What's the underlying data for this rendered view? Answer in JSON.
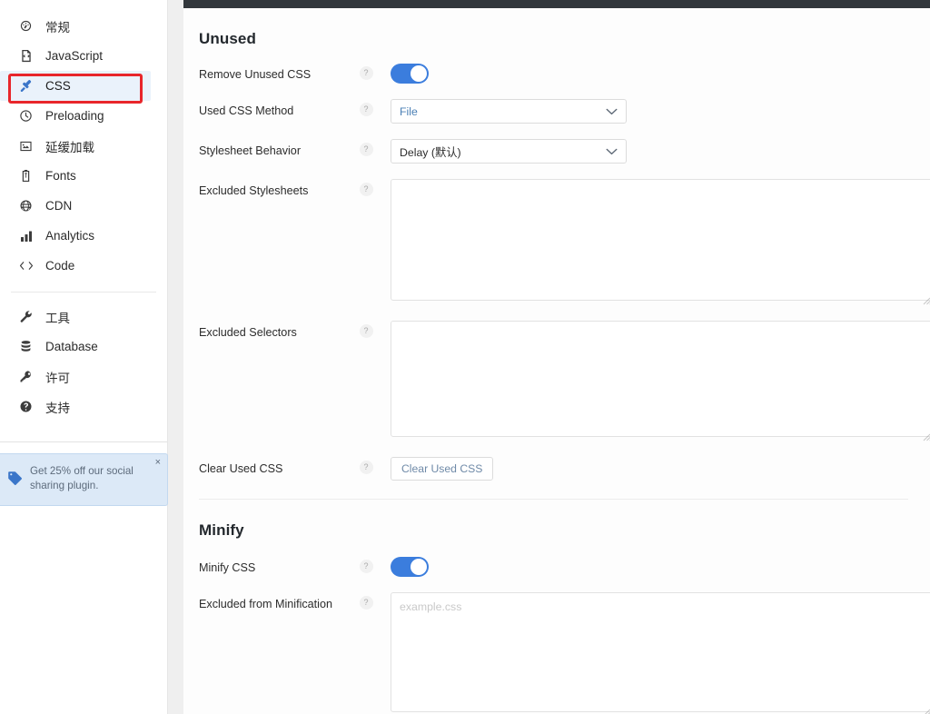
{
  "sidebar": {
    "groups": [
      {
        "items": [
          {
            "label": "常规",
            "icon": "gauge-icon",
            "active": false
          },
          {
            "label": "JavaScript",
            "icon": "code-file-icon",
            "active": false
          },
          {
            "label": "CSS",
            "icon": "paintbrush-icon",
            "active": true
          },
          {
            "label": "Preloading",
            "icon": "clock-icon",
            "active": false
          },
          {
            "label": "延缓加载",
            "icon": "image-icon",
            "active": false
          },
          {
            "label": "Fonts",
            "icon": "font-clipboard-icon",
            "active": false
          },
          {
            "label": "CDN",
            "icon": "globe-icon",
            "active": false
          },
          {
            "label": "Analytics",
            "icon": "bar-chart-icon",
            "active": false
          },
          {
            "label": "Code",
            "icon": "code-brackets-icon",
            "active": false
          }
        ]
      },
      {
        "items": [
          {
            "label": "工具",
            "icon": "wrench-icon",
            "active": false
          },
          {
            "label": "Database",
            "icon": "database-icon",
            "active": false
          },
          {
            "label": "许可",
            "icon": "key-icon",
            "active": false
          },
          {
            "label": "支持",
            "icon": "help-circle-icon",
            "active": false
          }
        ]
      }
    ],
    "promo": {
      "text": "Get 25% off our social sharing plugin.",
      "close_label": "×",
      "icon": "price-tag-icon",
      "bg_color": "#dce9f7",
      "accent_color": "#3b76c9"
    },
    "annotation": {
      "target": "CSS",
      "color": "#e8262b"
    }
  },
  "content": {
    "sections": [
      {
        "title": "Unused",
        "rows": [
          {
            "label": "Remove Unused CSS",
            "help": "?",
            "control": "toggle",
            "toggle_on": true
          },
          {
            "label": "Used CSS Method",
            "help": "?",
            "control": "select",
            "value": "File"
          },
          {
            "label": "Stylesheet Behavior",
            "help": "?",
            "control": "select",
            "value": "Delay (默认)"
          },
          {
            "label": "Excluded Stylesheets",
            "help": "?",
            "control": "textarea",
            "value": "",
            "placeholder": ""
          },
          {
            "label": "Excluded Selectors",
            "help": "?",
            "control": "textarea",
            "value": "",
            "placeholder": ""
          },
          {
            "label": "Clear Used CSS",
            "help": "?",
            "control": "button",
            "button_label": "Clear Used CSS"
          }
        ]
      },
      {
        "title": "Minify",
        "rows": [
          {
            "label": "Minify CSS",
            "help": "?",
            "control": "toggle",
            "toggle_on": true
          },
          {
            "label": "Excluded from Minification",
            "help": "?",
            "control": "textarea",
            "value": "",
            "placeholder": "example.css"
          }
        ]
      }
    ],
    "colors": {
      "admin_bar": "#32373c",
      "toggle_on": "#3b7ddd",
      "link_text": "#4a7fb5"
    }
  }
}
